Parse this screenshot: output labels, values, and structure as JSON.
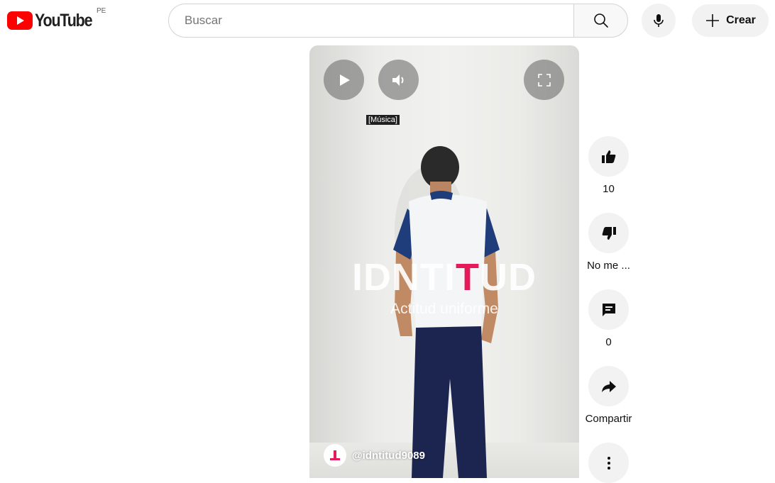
{
  "header": {
    "logo_text": "YouTube",
    "country_code": "PE",
    "search": {
      "placeholder": "Buscar",
      "value": ""
    },
    "create_label": "Crear"
  },
  "player": {
    "caption": "[Música]",
    "overlay_title_parts": [
      "IDNTI",
      "T",
      "UD"
    ],
    "overlay_subtitle": "Actitud uniforme",
    "channel_handle": "@idntitud9089",
    "accent_color": "#e6195a"
  },
  "actions": {
    "like_count": "10",
    "dislike_label": "No me ...",
    "comment_count": "0",
    "share_label": "Compartir"
  },
  "icons": {
    "header": [
      "youtube-logo-icon",
      "search-icon",
      "microphone-icon",
      "plus-icon"
    ],
    "player": [
      "play-icon",
      "volume-icon",
      "fullscreen-icon",
      "channel-avatar-icon"
    ],
    "actions": [
      "thumbs-up-icon",
      "thumbs-down-icon",
      "comment-icon",
      "share-icon",
      "more-vertical-icon"
    ]
  },
  "colors": {
    "youtube_red": "#ff0000",
    "button_bg": "#f2f2f2"
  }
}
